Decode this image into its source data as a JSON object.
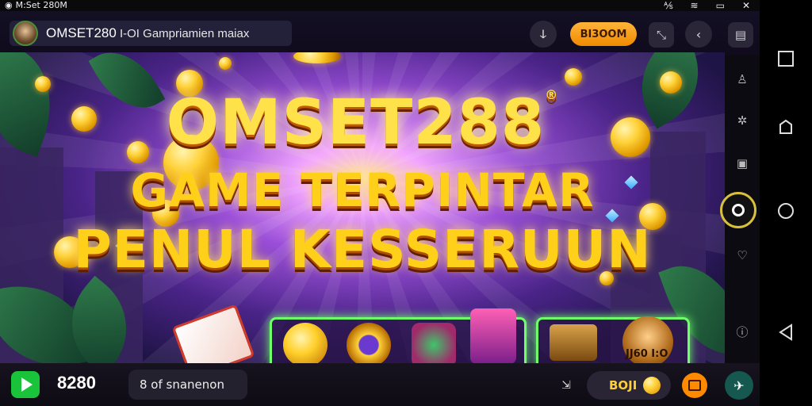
{
  "status_bar": {
    "app_label": "M:Set 280M",
    "icons": [
      "wifi-icon",
      "signal-icon",
      "battery-icon",
      "close-icon"
    ]
  },
  "header": {
    "title_bold": "OMSET280",
    "title_rest": " I-OI Gampriamien maiax",
    "refresh_icon": "ↆ",
    "cta_label": "BI3OOM",
    "buttons": [
      "expand-icon",
      "back-icon",
      "menu-icon"
    ]
  },
  "banner": {
    "headline_line1": "OMSET288",
    "registered_mark": "®",
    "headline_line2": "GAME TERPINTAR",
    "headline_line3": "PENUL KESSERUUN",
    "reward_label": "JJ60 I:O"
  },
  "bottom_bar": {
    "score": "8280",
    "field_text": "8 of snanenon",
    "coin_label": "BOJI",
    "coin_symbol": "L"
  },
  "side_rail": {
    "icons": [
      "person-icon",
      "settings-icon",
      "video-icon",
      "record-icon",
      "heart-icon",
      "info-icon"
    ]
  },
  "colors": {
    "accent_orange": "#ff8a00",
    "accent_green": "#19c33a",
    "panel_glow": "#6fff6a",
    "headline_gold": "#ffd01a"
  }
}
